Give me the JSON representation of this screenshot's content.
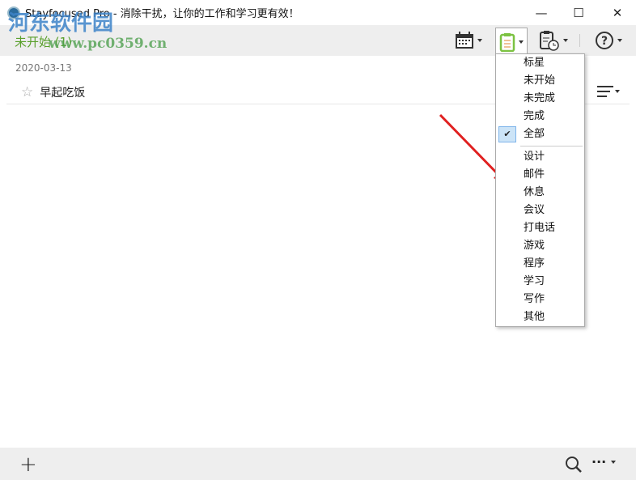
{
  "window": {
    "title": "Stayfocused Pro - 消除干扰，让你的工作和学习更有效！",
    "minimize": "—",
    "maximize": "☐",
    "close": "✕"
  },
  "toolbar": {
    "filter_title": "未开始 (1)",
    "icons": [
      "calendar-icon",
      "task-list-icon",
      "schedule-icon",
      "help-icon"
    ],
    "accent": "#5aa02c"
  },
  "list": {
    "date": "2020-03-13",
    "tasks": [
      {
        "title": "早起吃饭",
        "starred": false
      }
    ]
  },
  "menu": {
    "items": [
      "标星",
      "未开始",
      "未完成",
      "完成",
      "全部"
    ],
    "checked": "未开始",
    "categories": [
      "设计",
      "邮件",
      "休息",
      "会议",
      "打电话",
      "游戏",
      "程序",
      "学习",
      "写作",
      "其他"
    ]
  },
  "bottom": {
    "add": "+",
    "more": "···"
  },
  "watermark": {
    "name": "河东软件园",
    "url": "www.pc0359.cn"
  }
}
